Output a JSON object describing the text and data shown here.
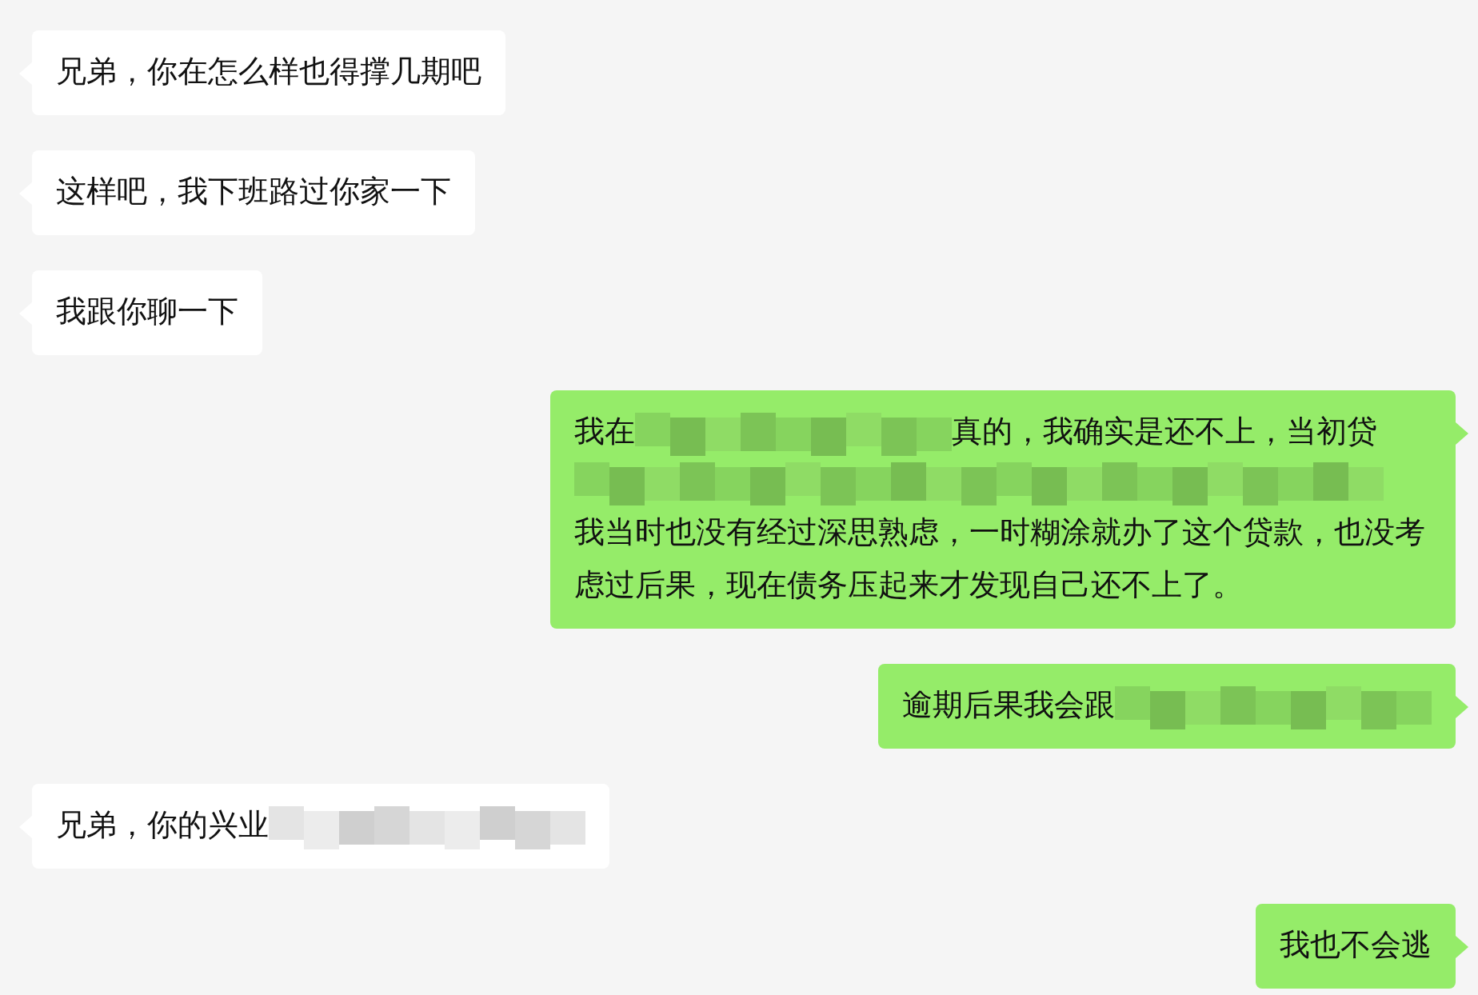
{
  "messages": [
    {
      "kind": "incoming",
      "parts": [
        {
          "kind": "text",
          "text": "兄弟，你在怎么样也得撑几期吧"
        }
      ]
    },
    {
      "kind": "incoming",
      "parts": [
        {
          "kind": "text",
          "text": "这样吧，我下班路过你家一下"
        }
      ]
    },
    {
      "kind": "incoming",
      "parts": [
        {
          "kind": "text",
          "text": "我跟你聊一下"
        }
      ]
    },
    {
      "kind": "outgoing",
      "parts": [
        {
          "kind": "text",
          "text": "我在"
        },
        {
          "kind": "mosaic"
        },
        {
          "kind": "text",
          "text": "真的，我确实是还不上，当初贷"
        },
        {
          "kind": "mosaic_line"
        },
        {
          "kind": "text",
          "text": "我当时也没有经过深思熟虑，一时糊涂就办了这个贷款，也没考虑过后果，现在债务压起来才发现自己还不上了。"
        }
      ]
    },
    {
      "kind": "outgoing",
      "parts": [
        {
          "kind": "text",
          "text": "逾期后果我会跟"
        },
        {
          "kind": "mosaic"
        }
      ]
    },
    {
      "kind": "incoming",
      "parts": [
        {
          "kind": "text",
          "text": "兄弟，你的兴业"
        },
        {
          "kind": "mosaic"
        }
      ]
    },
    {
      "kind": "outgoing",
      "parts": [
        {
          "kind": "text",
          "text": "我也不会逃"
        }
      ]
    }
  ]
}
